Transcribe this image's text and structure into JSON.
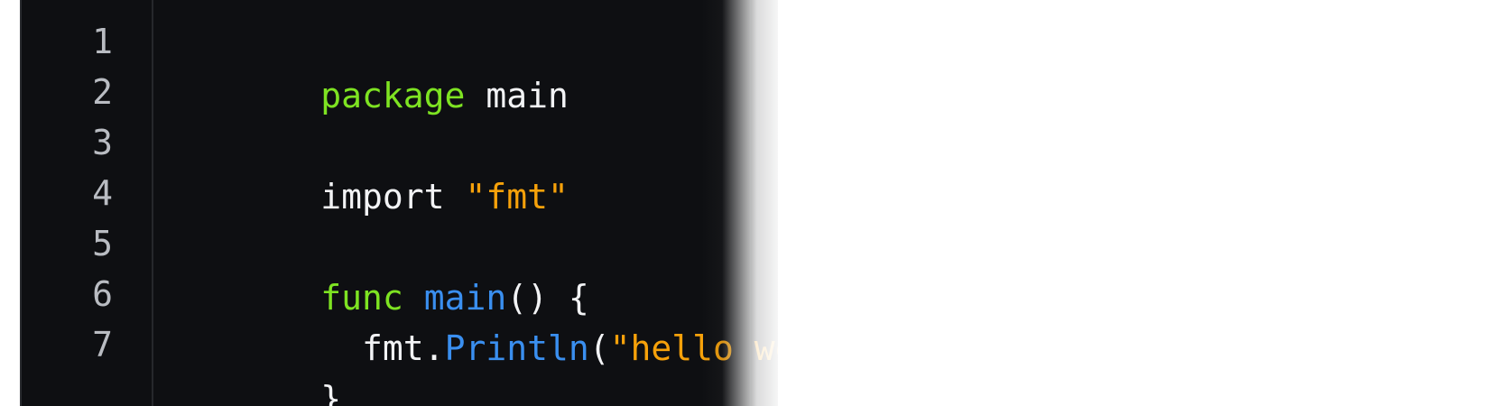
{
  "editor": {
    "line_numbers": [
      "1",
      "2",
      "3",
      "4",
      "5",
      "6",
      "7"
    ],
    "lines": [
      {
        "tokens": [
          {
            "text": "package",
            "kind": "keyword"
          },
          {
            "text": " main",
            "kind": "plain"
          }
        ]
      },
      {
        "tokens": []
      },
      {
        "tokens": [
          {
            "text": "import",
            "kind": "plain"
          },
          {
            "text": " ",
            "kind": "plain"
          },
          {
            "text": "\"fmt\"",
            "kind": "string"
          }
        ]
      },
      {
        "tokens": []
      },
      {
        "tokens": [
          {
            "text": "func",
            "kind": "keyword"
          },
          {
            "text": " ",
            "kind": "plain"
          },
          {
            "text": "main",
            "kind": "function"
          },
          {
            "text": "() {",
            "kind": "plain"
          }
        ]
      },
      {
        "tokens": [
          {
            "text": "  fmt.",
            "kind": "plain"
          },
          {
            "text": "Println",
            "kind": "function"
          },
          {
            "text": "(",
            "kind": "plain"
          },
          {
            "text": "\"hello world",
            "kind": "string"
          }
        ]
      },
      {
        "tokens": [
          {
            "text": "}",
            "kind": "plain"
          }
        ]
      }
    ],
    "colors": {
      "background": "#0e0f12",
      "keyword": "#7ee322",
      "string": "#f6a10a",
      "function": "#3a8ff0",
      "plain": "#f2f3f5",
      "line_number": "#b9bcc2"
    }
  }
}
